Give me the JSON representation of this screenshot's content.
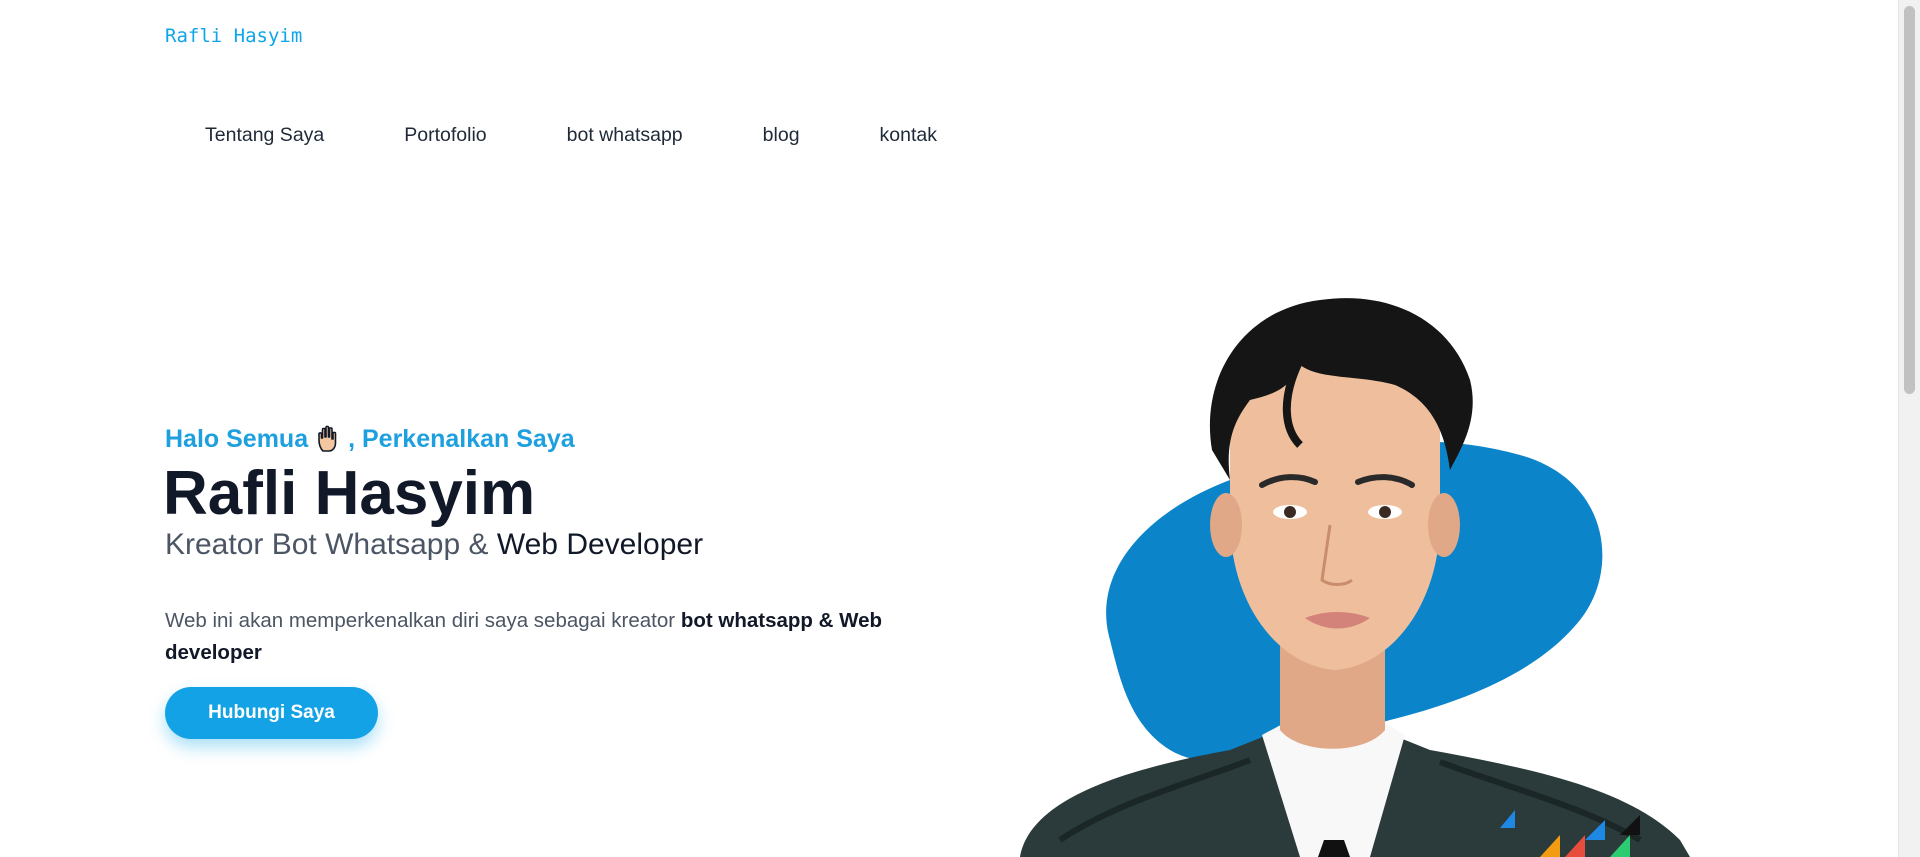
{
  "brand": "Rafli Hasyim",
  "nav": [
    {
      "label": "Tentang Saya"
    },
    {
      "label": "Portofolio"
    },
    {
      "label": "bot whatsapp"
    },
    {
      "label": "blog"
    },
    {
      "label": "kontak"
    }
  ],
  "hero": {
    "greeting_before": "Halo Semua",
    "greeting_after": ", Perkenalkan Saya",
    "name": "Rafli Hasyim",
    "subtitle_part1": "Kreator Bot Whatsapp & ",
    "subtitle_part2": "Web Developer",
    "desc_text": "Web ini akan memperkenalkan diri saya sebagai kreator ",
    "desc_bold": "bot whatsapp & Web developer",
    "cta_label": "Hubungi Saya"
  },
  "colors": {
    "accent": "#0ea5e9",
    "blob": "#0b84c9",
    "heading": "#111827",
    "body_text": "#4b5563"
  },
  "icons": {
    "greeting": "raised-hand-icon"
  }
}
